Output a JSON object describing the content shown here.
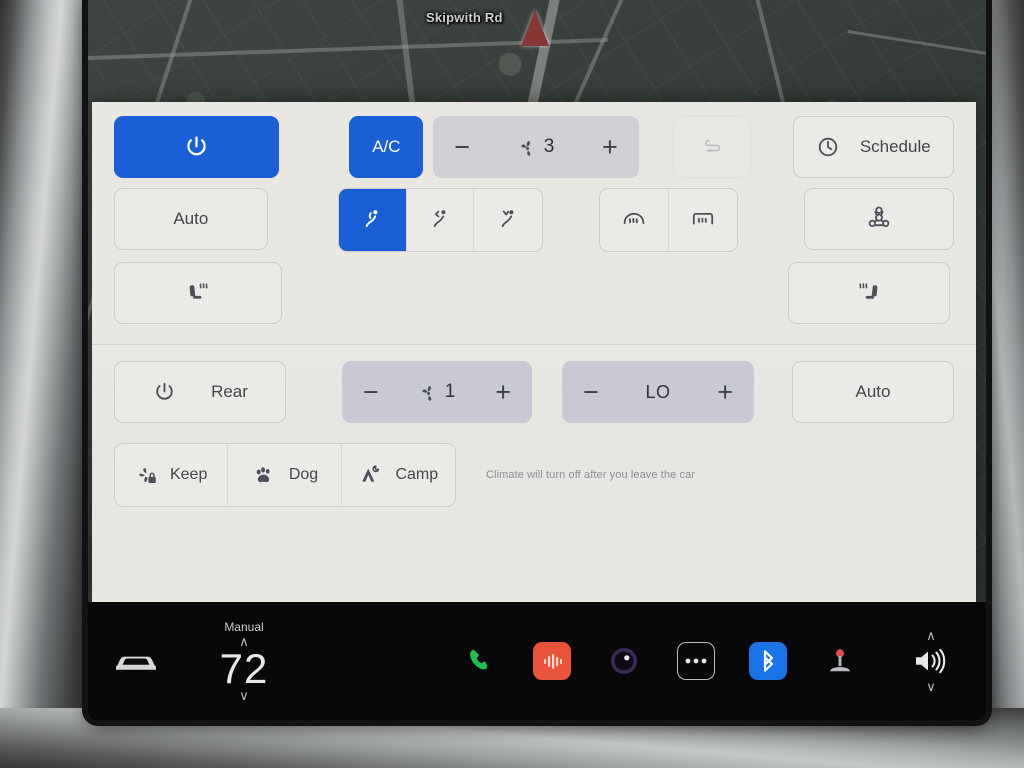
{
  "device": {
    "name": "tesla-center-touchscreen"
  },
  "map": {
    "street_label": "Skipwith Rd",
    "nav_marker": "navigation-arrow"
  },
  "climate": {
    "front": {
      "power": {
        "label": "",
        "icon": "power-icon",
        "state": "on"
      },
      "ac": {
        "label": "A/C",
        "state": "on"
      },
      "fan": {
        "minus": "−",
        "plus": "+",
        "icon": "fan-icon",
        "value": "3"
      },
      "recirculate": {
        "icon": "recirculate-icon",
        "state": "off"
      },
      "schedule": {
        "label": "Schedule",
        "icon": "clock-icon"
      },
      "auto": {
        "label": "Auto",
        "state": "off"
      },
      "airflow": [
        {
          "name": "airflow-face-icon",
          "state": "on"
        },
        {
          "name": "airflow-face-feet-icon",
          "state": "off"
        },
        {
          "name": "airflow-feet-icon",
          "state": "off"
        }
      ],
      "defrost_front": {
        "icon": "windshield-defrost-icon",
        "state": "off"
      },
      "defrost_rear": {
        "icon": "rear-defrost-icon",
        "state": "off"
      },
      "bioweapon": {
        "icon": "biohazard-icon",
        "state": "off"
      },
      "seat_heater_driver": {
        "icon": "heated-seat-left-icon",
        "state": "off"
      },
      "seat_heater_passenger": {
        "icon": "heated-seat-right-icon",
        "state": "off"
      }
    },
    "rear": {
      "power": {
        "label": "Rear",
        "icon": "power-icon",
        "state": "off"
      },
      "fan": {
        "minus": "−",
        "plus": "+",
        "icon": "fan-icon",
        "value": "1"
      },
      "temp": {
        "minus": "−",
        "plus": "+",
        "value": "LO"
      },
      "auto": {
        "label": "Auto",
        "state": "off"
      }
    },
    "modes": [
      {
        "label": "Keep",
        "icon": "keep-climate-on-icon"
      },
      {
        "label": "Dog",
        "icon": "paw-icon"
      },
      {
        "label": "Camp",
        "icon": "tent-icon"
      }
    ],
    "note": "Climate will turn off after you leave the car"
  },
  "taskbar": {
    "car_icon": "car-icon",
    "temperature": {
      "mode": "Manual",
      "value": "72",
      "up": "∧",
      "down": "∨"
    },
    "apps": [
      {
        "name": "phone-icon",
        "color": "#1fbf55"
      },
      {
        "name": "media-icon",
        "color": "#e8543a"
      },
      {
        "name": "dashcam-icon",
        "color": "#2a1d3d"
      },
      {
        "name": "more-apps-icon",
        "color": "#0c0c0e"
      },
      {
        "name": "bluetooth-icon",
        "color": "#1a74e8"
      },
      {
        "name": "arcade-joystick-icon",
        "color": "#e0504f"
      }
    ],
    "volume": {
      "icon": "speaker-icon",
      "up": "∧",
      "down": "∨"
    }
  },
  "colors": {
    "accent_blue": "#1a5fd6",
    "panel_bg": "#e9e7e2",
    "taskbar_bg": "#08080a",
    "icon_gray": "#4c5159"
  }
}
